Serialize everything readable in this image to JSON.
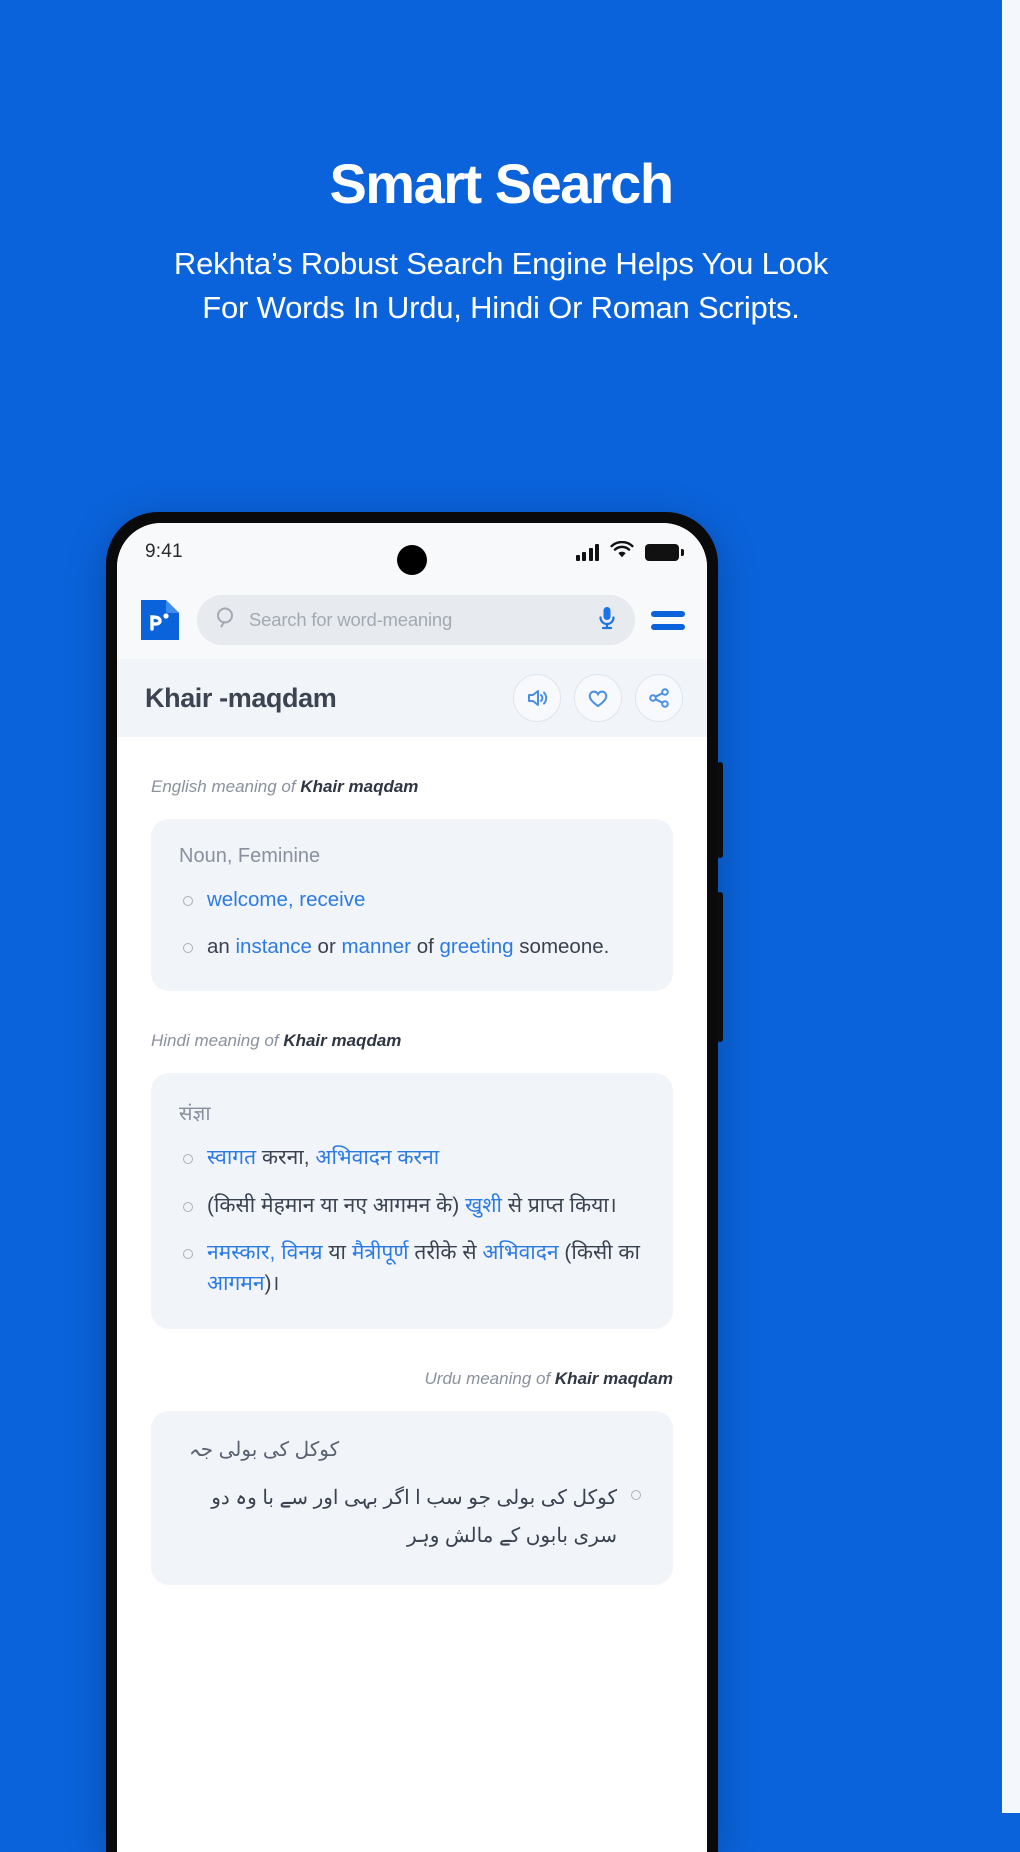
{
  "promo": {
    "title": "Smart Search",
    "subtitle": "Rekhta’s Robust Search Engine Helps You Look For Words In Urdu, Hindi Or Roman Scripts."
  },
  "status_bar": {
    "time": "9:41",
    "icons": [
      "signal-icon",
      "wifi-icon",
      "battery-icon"
    ]
  },
  "app_bar": {
    "logo": "rekhta-logo-icon",
    "search_placeholder": "Search for word-meaning",
    "search_value": "",
    "search_icon": "search-icon",
    "mic_icon": "microphone-icon",
    "menu_icon": "hamburger-menu-icon"
  },
  "word_header": {
    "title": "Khair -maqdam",
    "actions": [
      {
        "name": "audio-pronounce-button",
        "icon": "speaker-icon"
      },
      {
        "name": "favorite-button",
        "icon": "heart-icon"
      },
      {
        "name": "share-button",
        "icon": "share-icon"
      }
    ]
  },
  "sections": {
    "english": {
      "label_prefix": "English meaning of ",
      "label_word": "Khair maqdam",
      "pos": "Noun, Feminine",
      "meanings": [
        [
          {
            "t": "welcome, receive",
            "link": true
          }
        ],
        [
          {
            "t": "an ",
            "link": false
          },
          {
            "t": "instance",
            "link": true
          },
          {
            "t": " or ",
            "link": false
          },
          {
            "t": "manner",
            "link": true
          },
          {
            "t": " of ",
            "link": false
          },
          {
            "t": "greeting",
            "link": true
          },
          {
            "t": " someone.",
            "link": false
          }
        ]
      ]
    },
    "hindi": {
      "label_prefix": "Hindi meaning of ",
      "label_word": "Khair maqdam",
      "pos": "संज्ञा",
      "meanings": [
        [
          {
            "t": "स्वागत",
            "link": true
          },
          {
            "t": " करना, ",
            "link": false
          },
          {
            "t": "अभिवादन करना",
            "link": true
          }
        ],
        [
          {
            "t": "(किसी मेहमान या नए आगमन के) ",
            "link": false
          },
          {
            "t": "खुशी",
            "link": true
          },
          {
            "t": " से प्राप्त किया।",
            "link": false
          }
        ],
        [
          {
            "t": "नमस्कार, विनम्र",
            "link": true
          },
          {
            "t": " या ",
            "link": false
          },
          {
            "t": "मैत्रीपूर्ण",
            "link": true
          },
          {
            "t": " तरीके से ",
            "link": false
          },
          {
            "t": "अभिवादन",
            "link": true
          },
          {
            "t": " (किसी का ",
            "link": false
          },
          {
            "t": "आगमन",
            "link": true
          },
          {
            "t": ")।",
            "link": false
          }
        ]
      ]
    },
    "urdu": {
      "label_prefix": "Urdu meaning of ",
      "label_word": "Khair maqdam",
      "pos": "کوکل کی بولی جہ",
      "meanings": [
        [
          {
            "t": "کوکل کی بولی جو سب ا اگر بہی اور سے با وہ دو سری بابوں کے مالش وہر",
            "link": false
          }
        ]
      ]
    }
  }
}
